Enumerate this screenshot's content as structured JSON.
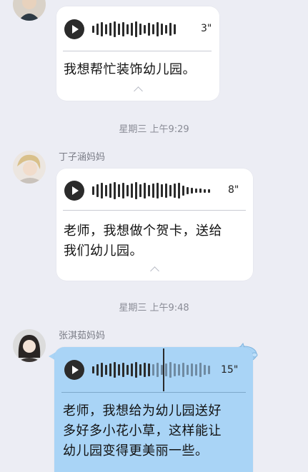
{
  "messages": [
    {
      "sender": "",
      "voice": {
        "duration": "3\""
      },
      "text_lines": [
        "我想帮忙装饰幼儿园。"
      ]
    },
    {
      "sender": "丁子涵妈妈",
      "voice": {
        "duration": "8\""
      },
      "text_lines": [
        "老师，我想做个贺卡，送给",
        "我们幼儿园。"
      ]
    },
    {
      "sender": "张淇茹妈妈",
      "voice": {
        "duration": "15\""
      },
      "text_lines": [
        "老师，我想给为幼儿园送好",
        "多好多小花小草，这样能让",
        "幼儿园变得更美丽一些。"
      ]
    }
  ],
  "timestamps": [
    "星期三 上午9:29",
    "星期三 上午9:48"
  ],
  "colors": {
    "background": "#ecedf4",
    "bubble": "#ffffff",
    "bubble_playing": "#a9d4f6"
  },
  "icons": [
    "play-icon",
    "waveform-icon",
    "chevron-up-icon",
    "avatar"
  ]
}
